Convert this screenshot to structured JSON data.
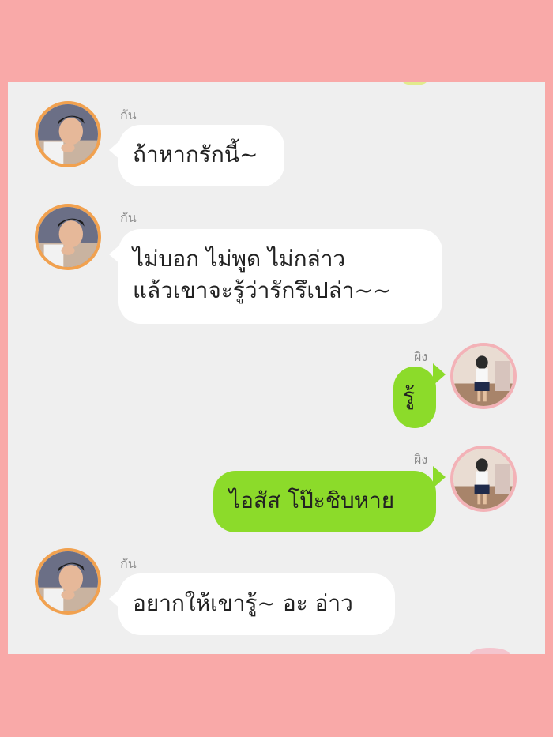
{
  "colors": {
    "page_background": "#f9a9a8",
    "chat_background": "#efefef",
    "incoming_bubble": "#ffffff",
    "outgoing_bubble": "#8cdb2a"
  },
  "messages": [
    {
      "sender": "กัน",
      "direction": "incoming",
      "text": "ถ้าหากรักนี้~",
      "avatar": "boy-avatar"
    },
    {
      "sender": "กัน",
      "direction": "incoming",
      "text": "ไม่บอก ไม่พูด ไม่กล่าว\nแล้วเขาจะรู้ว่ารักรึเปล่า~~",
      "avatar": "boy-avatar"
    },
    {
      "sender": "ผิง",
      "direction": "outgoing",
      "text": "รู้",
      "avatar": "girl-avatar"
    },
    {
      "sender": "ผิง",
      "direction": "outgoing",
      "text": "ไอสัส โป๊ะชิบหาย",
      "avatar": "girl-avatar"
    },
    {
      "sender": "กัน",
      "direction": "incoming",
      "text": "อยากให้เขารู้~  อะ อ่าว",
      "avatar": "boy-avatar"
    }
  ]
}
